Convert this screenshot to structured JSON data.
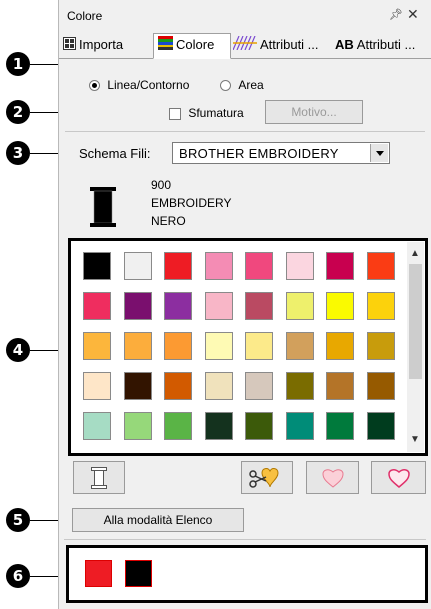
{
  "panel": {
    "title": "Colore",
    "pin_glyph": "↓",
    "close_glyph": "✕"
  },
  "tabs": [
    {
      "label": "Importa",
      "icon": "import-icon"
    },
    {
      "label": "Colore",
      "icon": "color-palette-icon",
      "active": true
    },
    {
      "label": "Attributi ...",
      "icon": "stitch-attributes-icon"
    },
    {
      "label": "Attributi ...",
      "prefix": "AB",
      "icon": "text-attributes-icon"
    }
  ],
  "mode": {
    "line_label": "Linea/Contorno",
    "area_label": "Area",
    "selected": "line"
  },
  "gradient": {
    "label": "Sfumatura",
    "checked": false,
    "pattern_button": "Motivo..."
  },
  "scheme": {
    "label": "Schema Fili:",
    "value": "BROTHER EMBROIDERY"
  },
  "current_thread": {
    "code": "900",
    "brand": "EMBROIDERY",
    "name": "NERO",
    "color": "#000000"
  },
  "palette": [
    [
      "#000000",
      "#f0f0f0",
      "#ee1c24",
      "#f48cb4",
      "#f0487e",
      "#fbd6e0",
      "#c8004f",
      "#fa3c14"
    ],
    [
      "#ef2d5f",
      "#7a0f6e",
      "#8c2ea0",
      "#f8b6c7",
      "#ba4a62",
      "#eef06c",
      "#fafa00",
      "#fcd20c"
    ],
    [
      "#fcb63c",
      "#fcad3c",
      "#fc9a32",
      "#fefab4",
      "#fcea8a",
      "#d2a05c",
      "#e8a800",
      "#c89c0c"
    ],
    [
      "#fee6c8",
      "#321400",
      "#d25a00",
      "#f0e2bc",
      "#d6c8bc",
      "#7a6c00",
      "#b47428",
      "#965a00"
    ],
    [
      "#a6dcc4",
      "#96d87a",
      "#5ab446",
      "#14321e",
      "#3c5a0a",
      "#008c78",
      "#007a3c",
      "#003c1e"
    ]
  ],
  "tools": {
    "thread_icon": "spool-icon",
    "refresh_icon": "scissors-heart-icon",
    "light_icon": "light-heart-icon",
    "outline_icon": "heart-outline-icon"
  },
  "list_mode_button": "Alla modalità Elenco",
  "selected_colors": [
    "#ee1c24",
    "#000000"
  ],
  "callouts": [
    "1",
    "2",
    "3",
    "4",
    "5",
    "6"
  ]
}
